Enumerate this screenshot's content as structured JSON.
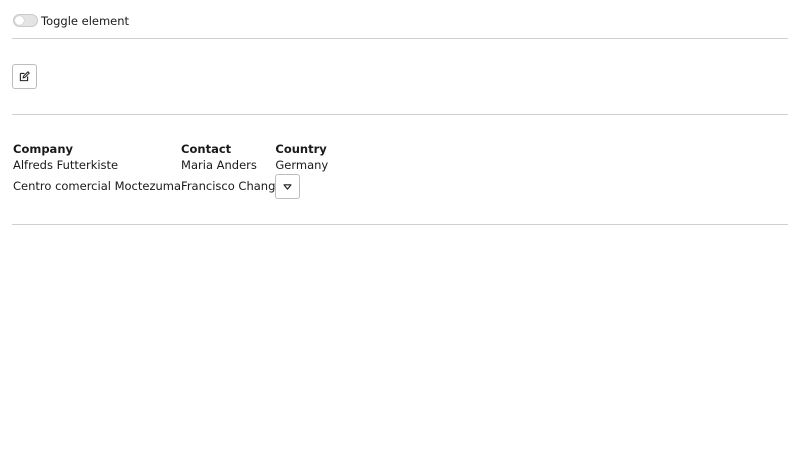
{
  "toggle": {
    "label": "Toggle element",
    "checked": false,
    "icon": "toggle-switch"
  },
  "toolbar": {
    "edit_icon": "edit-icon"
  },
  "table": {
    "headers": [
      "Company",
      "Contact",
      "Country"
    ],
    "rows": [
      {
        "company": "Alfreds Futterkiste",
        "contact": "Maria Anders",
        "country": "Germany"
      },
      {
        "company": "Centro comercial Moctezuma",
        "contact": "Francisco Chang",
        "country": ""
      }
    ],
    "dropdown_icon": "chevron-down-icon"
  },
  "colors": {
    "divider": "#cfcfcf",
    "border": "#bdbdbd",
    "text": "#1a1a1a"
  }
}
